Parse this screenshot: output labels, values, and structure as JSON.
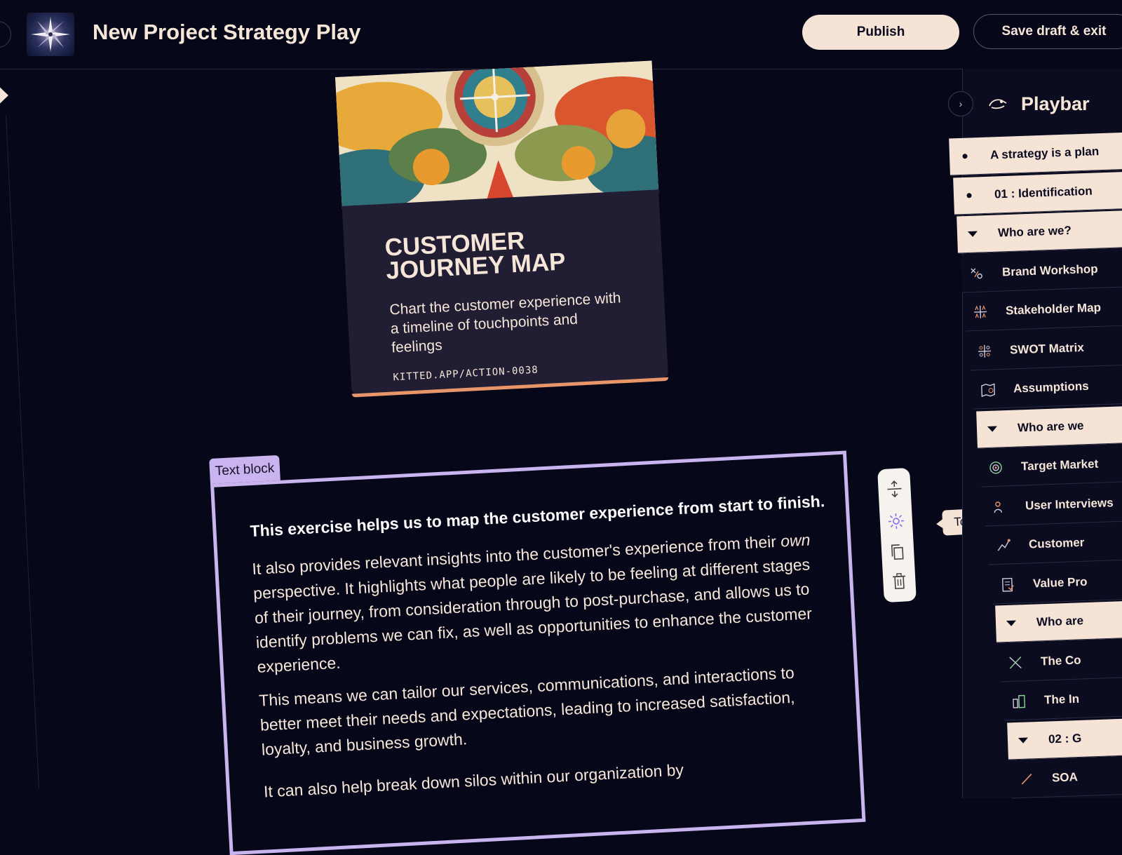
{
  "header": {
    "title": "New Project Strategy Play",
    "publish_label": "Publish",
    "save_label": "Save draft & exit"
  },
  "card": {
    "title_line1": "CUSTOMER",
    "title_line2": "JOURNEY MAP",
    "description": "Chart the customer experience with a timeline of touchpoints and feelings",
    "url": "KITTED.APP/ACTION-0038"
  },
  "text_block": {
    "tab_label": "Text block",
    "lead": "This exercise helps us to map the customer experience from start to finish.",
    "p1_before_em": "It also provides relevant insights into the customer's experience from their ",
    "p1_em": "own",
    "p1_after_em": " perspective. It highlights what people are likely to be feeling at different stages of their journey, from consideration through to post-purchase, and allows us to identify problems we can fix, as well as opportunities to enhance the customer experience.",
    "p2": "This means we can tailor our services, communications, and interactions to better meet their needs and expectations, leading to increased satisfaction, loyalty, and business growth.",
    "p3": "It can also help break down silos within our organization by"
  },
  "toolbar": {
    "tooltip": "Toggle Theme",
    "tools": [
      "resize-icon",
      "sun-icon",
      "copy-icon",
      "trash-icon"
    ]
  },
  "playbar": {
    "title": "Playbar",
    "items": [
      {
        "label": "A strategy is a plan",
        "kind": "bullet",
        "style": "light"
      },
      {
        "label": "01 : Identification",
        "kind": "bullet",
        "style": "light"
      },
      {
        "label": "Who are we?",
        "kind": "caret",
        "style": "light"
      },
      {
        "label": "Brand Workshop",
        "kind": "icon",
        "icon": "tactics-icon",
        "style": "dark"
      },
      {
        "label": "Stakeholder Map",
        "kind": "icon",
        "icon": "grid-icon",
        "style": "dark"
      },
      {
        "label": "SWOT Matrix",
        "kind": "icon",
        "icon": "swot-icon",
        "style": "dark"
      },
      {
        "label": "Assumptions",
        "kind": "icon",
        "icon": "map-icon",
        "style": "dark"
      },
      {
        "label": "Who are we",
        "kind": "caret",
        "style": "light"
      },
      {
        "label": "Target Market",
        "kind": "icon",
        "icon": "target-icon",
        "style": "dark"
      },
      {
        "label": "User Interviews",
        "kind": "icon",
        "icon": "interview-icon",
        "style": "dark"
      },
      {
        "label": "Customer",
        "kind": "icon",
        "icon": "journey-icon",
        "style": "dark"
      },
      {
        "label": "Value Pro",
        "kind": "icon",
        "icon": "document-icon",
        "style": "dark"
      },
      {
        "label": "Who are",
        "kind": "caret",
        "style": "light"
      },
      {
        "label": "The Co",
        "kind": "icon",
        "icon": "swords-icon",
        "style": "dark"
      },
      {
        "label": "The In",
        "kind": "icon",
        "icon": "buildings-icon",
        "style": "dark"
      },
      {
        "label": "02 : G",
        "kind": "caret",
        "style": "light"
      },
      {
        "label": "SOA",
        "kind": "icon",
        "icon": "tool-icon",
        "style": "dark"
      }
    ]
  },
  "colors": {
    "background": "#07071a",
    "cream": "#f5e3d6",
    "lavender": "#c9b4ef",
    "card_body": "#211e33",
    "card_accent": "#e8956a"
  }
}
